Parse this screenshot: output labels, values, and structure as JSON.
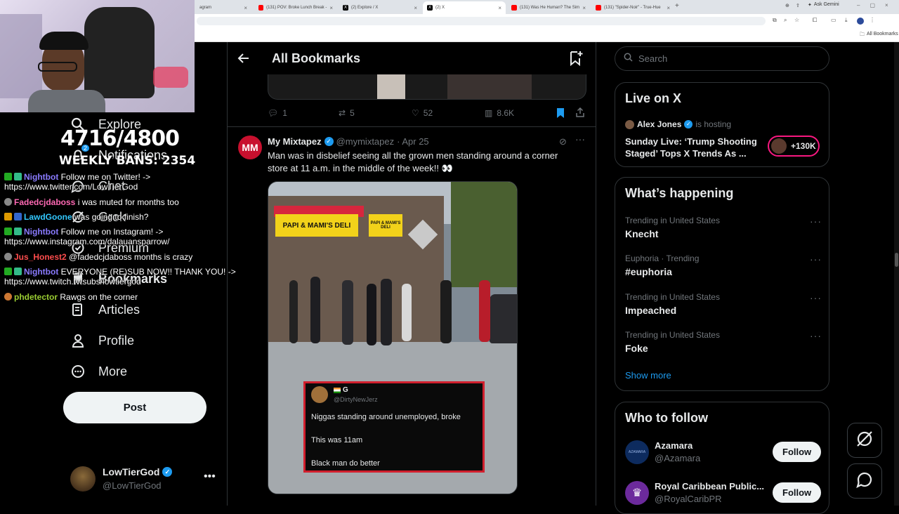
{
  "browser": {
    "tabs": [
      {
        "label": "agram",
        "active": false
      },
      {
        "label": "(131) POV: Broke Lunch Break -",
        "active": false
      },
      {
        "label": "(2) Explore / X",
        "active": false
      },
      {
        "label": "(2) X",
        "active": true
      },
      {
        "label": "(131) Was He Human? The Sim",
        "active": false
      },
      {
        "label": "(131) \"Spider-Noir\" - True-Hue",
        "active": false
      }
    ],
    "ask_gemini": "Ask Gemini",
    "all_bookmarks": "All Bookmarks"
  },
  "stream_overlay": {
    "sub_goal": "4716/4800",
    "weekly_bans": "WEEKLY BANS: 2354"
  },
  "chat": [
    {
      "name": "Nightbot",
      "color": "#8a7bff",
      "text": "Follow me on Twitter! ->",
      "line2": "https://www.twitter.com/LowTierGod"
    },
    {
      "name": "Fadedcjdaboss",
      "color": "#ff69b4",
      "text": "i was muted for months too"
    },
    {
      "name": "LawdGoone",
      "color": "#32c8ff",
      "text": "was going to finish?"
    },
    {
      "name": "Nightbot",
      "color": "#8a7bff",
      "text": "Follow me on Instagram! ->",
      "line2": "https://www.instagram.com/dalauansparrow/"
    },
    {
      "name": "Jus_Honest2",
      "color": "#ff4d4d",
      "text": "@fadedcjdaboss months is crazy"
    },
    {
      "name": "Nightbot",
      "color": "#8a7bff",
      "text": "EVERYONE (RE)SUB NOW!! THANK YOU! ->",
      "line2": "https://www.twitch.tv/subs/lowtiergod"
    },
    {
      "name": "phdetector",
      "color": "#9acd32",
      "text": "Rawgs on the corner"
    }
  ],
  "nav": {
    "explore": "Explore",
    "notifications": "Notifications",
    "notif_count": "2",
    "chat": "Chat",
    "grok": "Grok",
    "premium": "Premium",
    "bookmarks": "Bookmarks",
    "articles": "Articles",
    "profile": "Profile",
    "more": "More",
    "post": "Post"
  },
  "account": {
    "name": "LowTierGod",
    "handle": "@LowTierGod"
  },
  "header": {
    "title": "All Bookmarks"
  },
  "prev_tweet": {
    "replies": "1",
    "reposts": "5",
    "likes": "52",
    "views": "8.6K"
  },
  "tweet": {
    "author": "My Mixtapez",
    "handle": "@mymixtapez",
    "date": "· Apr 25",
    "text_line1": "Man was in disbelief seeing all the grown men standing around a corner",
    "text_line2": "store at 11 a.m. in the middle of the week!! 👀",
    "store_sign": "PAPI & MAMI'S DELI",
    "store_sign2": "PAPI & MAMI'S DELI",
    "inner": {
      "name": "G",
      "handle": "@DirtyNewJerz",
      "line1": "Niggas standing around unemployed, broke",
      "line2": "This was 11am",
      "line3": "Black man do better"
    }
  },
  "search": {
    "placeholder": "Search"
  },
  "live": {
    "title": "Live on X",
    "host": "Alex Jones",
    "hosting": "is hosting",
    "headline1": "Sunday Live: ‘Trump Shooting",
    "headline2": "Staged’ Tops X Trends As ...",
    "count": "+130K"
  },
  "happening": {
    "title": "What’s happening",
    "trends": [
      {
        "meta": "Trending in United States",
        "name": "Knecht"
      },
      {
        "meta": "Euphoria · Trending",
        "name": "#euphoria"
      },
      {
        "meta": "Trending in United States",
        "name": "Impeached"
      },
      {
        "meta": "Trending in United States",
        "name": "Foke"
      }
    ],
    "show_more": "Show more"
  },
  "who": {
    "title": "Who to follow",
    "accounts": [
      {
        "name": "Azamara",
        "handle": "@Azamara",
        "btn": "Follow",
        "logo": "AZAMARA"
      },
      {
        "name": "Royal Caribbean Public...",
        "handle": "@RoyalCaribPR",
        "btn": "Follow"
      }
    ]
  },
  "colors": {
    "accent": "#1d9bf0",
    "verified": "#1d9bf0",
    "live_pink": "#f91880"
  }
}
